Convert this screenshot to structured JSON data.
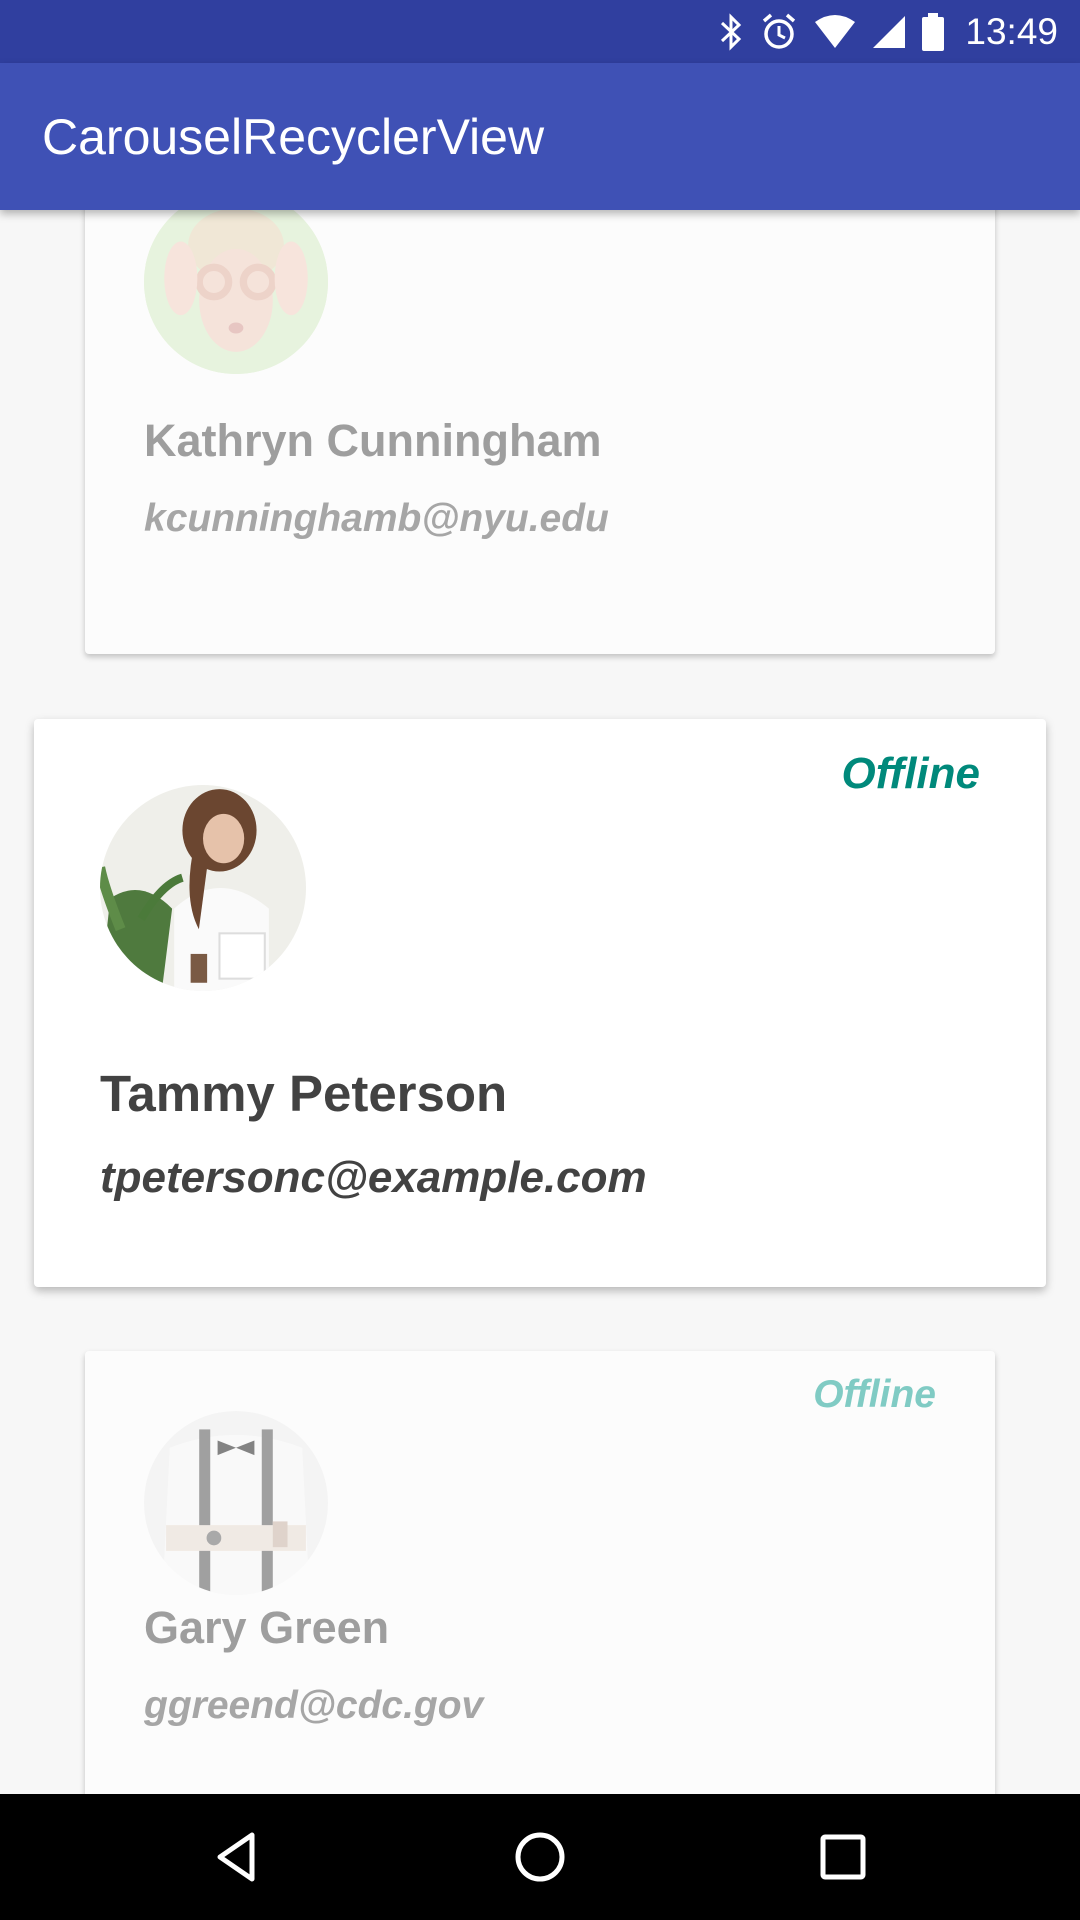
{
  "status_bar": {
    "time": "13:49",
    "icons": [
      "bluetooth-icon",
      "alarm-icon",
      "wifi-icon",
      "signal-icon",
      "battery-icon"
    ]
  },
  "app_bar": {
    "title": "CarouselRecyclerView"
  },
  "cards": [
    {
      "name": "Kathryn Cunningham",
      "email": "kcunninghamb@nyu.edu",
      "status": ""
    },
    {
      "name": "Tammy Peterson",
      "email": "tpetersonc@example.com",
      "status": "Offline"
    },
    {
      "name": "Gary Green",
      "email": "ggreend@cdc.gov",
      "status": "Offline"
    }
  ],
  "nav_bar": {
    "icons": [
      "back-icon",
      "home-icon",
      "recents-icon"
    ]
  },
  "colors": {
    "status_bar": "#303f9f",
    "app_bar": "#3f51b5",
    "status_active": "#00897b",
    "status_faded": "#80cbc4"
  }
}
